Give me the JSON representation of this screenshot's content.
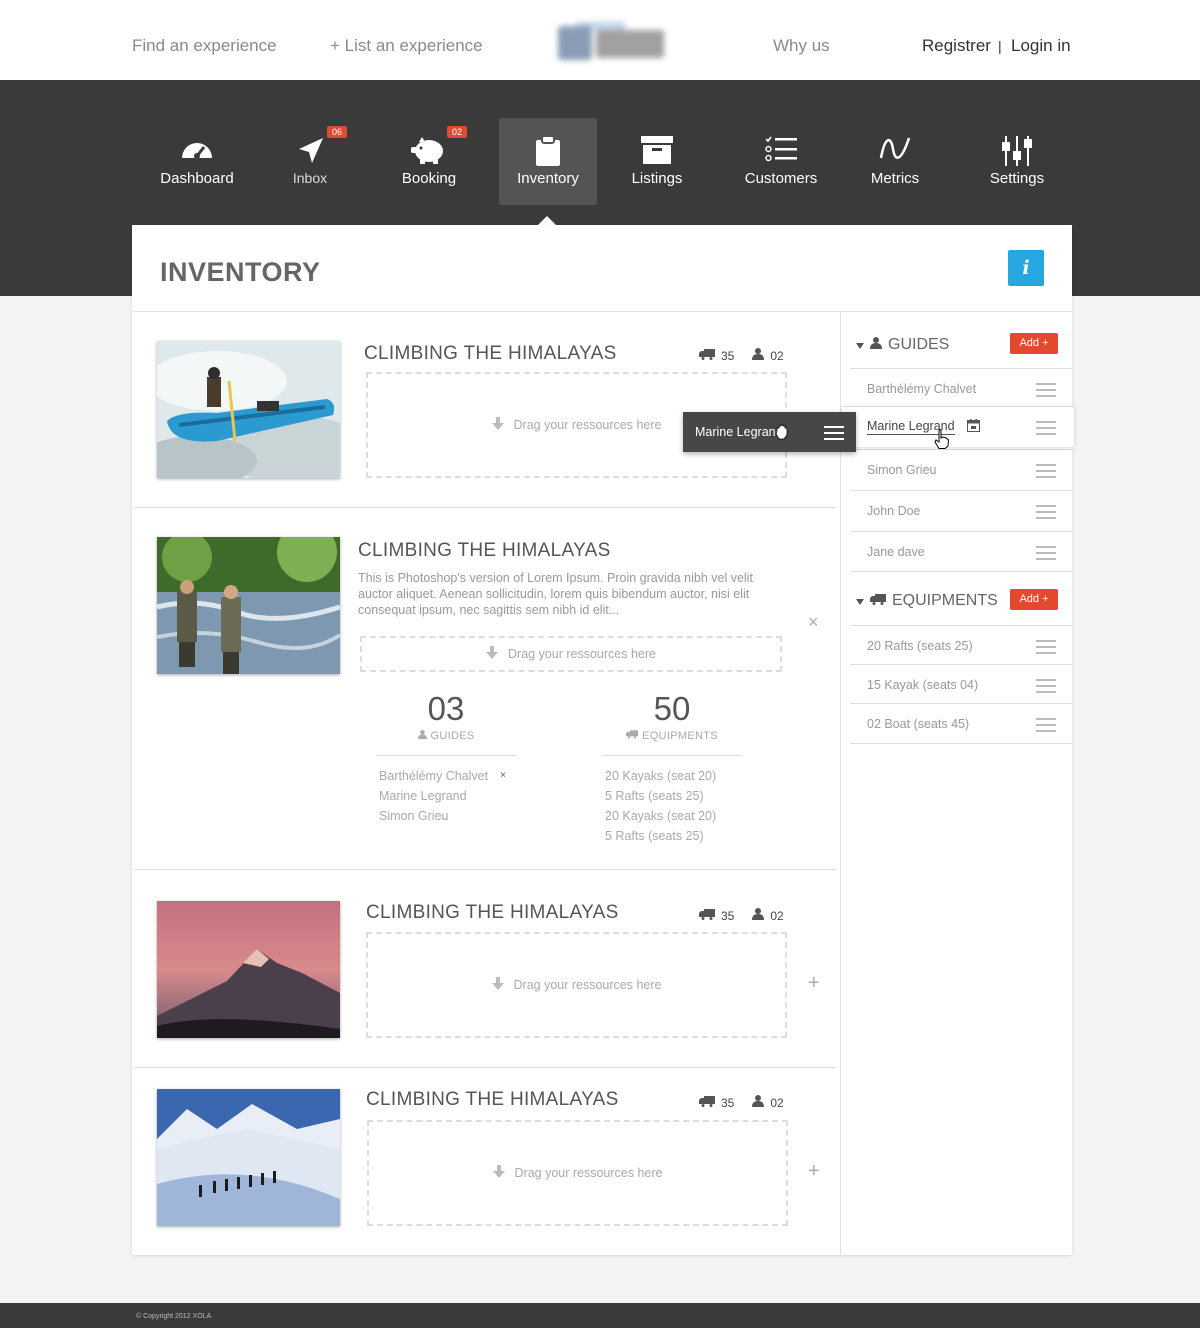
{
  "topnav": {
    "find": "Find an experience",
    "list": "+ List an experience",
    "why": "Why us",
    "register": "Registrer",
    "divider": "|",
    "login": "Login in"
  },
  "mainnav": [
    {
      "label": "Dashboard",
      "icon": "gauge-icon"
    },
    {
      "label": "Inbox",
      "icon": "paper-plane-icon",
      "badge": "06"
    },
    {
      "label": "Booking",
      "icon": "piggy-bank-icon",
      "badge": "02"
    },
    {
      "label": "Inventory",
      "icon": "clipboard-icon",
      "active": true
    },
    {
      "label": "Listings",
      "icon": "archive-box-icon"
    },
    {
      "label": "Customers",
      "icon": "checklist-icon"
    },
    {
      "label": "Metrics",
      "icon": "wave-icon"
    },
    {
      "label": "Settings",
      "icon": "sliders-icon"
    }
  ],
  "page": {
    "title": "INVENTORY",
    "info": "i"
  },
  "cards": [
    {
      "title": "CLIMBING THE HIMALAYAS",
      "equip_count": "35",
      "guide_count": "02",
      "drop": "Drag your ressources here"
    },
    {
      "title": "CLIMBING THE HIMALAYAS",
      "desc": "This is Photoshop's version  of Lorem Ipsum. Proin gravida nibh vel velit auctor aliquet. Aenean sollicitudin, lorem quis bibendum auctor, nisi elit consequat ipsum, nec sagittis sem nibh id elit...",
      "drop": "Drag your ressources here",
      "close": "×",
      "guides_num": "03",
      "guides_label": "GUIDES",
      "equip_num": "50",
      "equip_label": "EQUIPMENTS",
      "guides": [
        "Barthélémy Chalvet",
        "Marine Legrand",
        "Simon Grieu"
      ],
      "guide_remove": "×",
      "equipments": [
        "20 Kayaks (seat 20)",
        "5 Rafts (seats 25)",
        "20 Kayaks (seat 20)",
        "5 Rafts (seats 25)"
      ]
    },
    {
      "title": "CLIMBING THE HIMALAYAS",
      "equip_count": "35",
      "guide_count": "02",
      "drop": "Drag your ressources here",
      "add": "+"
    },
    {
      "title": "CLIMBING THE HIMALAYAS",
      "equip_count": "35",
      "guide_count": "02",
      "drop": "Drag your ressources here",
      "add": "+"
    }
  ],
  "drag_tooltip": "Marine Legrand",
  "sidebar": {
    "guides_title": "GUIDES",
    "guides_add": "Add +",
    "guides": [
      "Barthélémy Chalvet",
      "Marine Legrand",
      "Simon Grieu",
      "John Doe",
      "Jane dave"
    ],
    "equip_title": "EQUIPMENTS",
    "equip_add": "Add +",
    "equipments": [
      "20 Rafts (seats 25)",
      "15  Kayak (seats 04)",
      "02 Boat (seats 45)"
    ]
  },
  "footer": "© Copyright 2012 XOLA",
  "colors": {
    "accent": "#dd4b34",
    "info": "#27a7e0",
    "dark": "#3a3a3a"
  }
}
